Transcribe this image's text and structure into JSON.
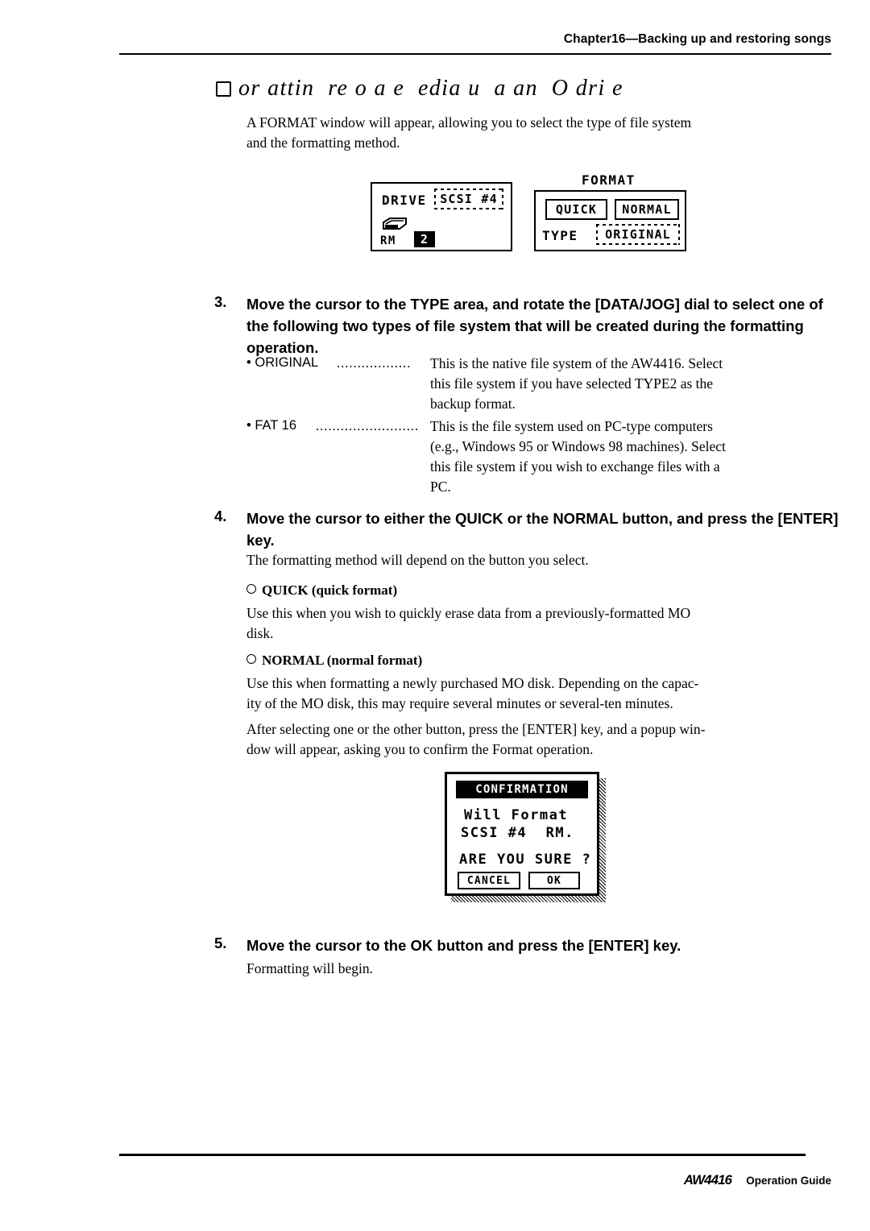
{
  "header": {
    "chapter": "Chapter16—Backing up and restoring songs"
  },
  "title": {
    "text": "or attin  re o a e  edia u  a an  O dri e"
  },
  "intro": {
    "line1": "A FORMAT window will appear, allowing you to select the type of file system",
    "line2": "and the formatting method."
  },
  "figure1": {
    "drive_label": "DRIVE",
    "drive_value": "SCSI #4",
    "rm_label": "RM",
    "rm_value": "2",
    "format_label": "FORMAT",
    "quick_button": "QUICK",
    "normal_button": "NORMAL",
    "type_label": "TYPE",
    "type_value": "ORIGINAL"
  },
  "step3": {
    "number": "3.",
    "line1": "Move the cursor to the TYPE area, and rotate the [DATA/JOG] dial to",
    "line2": "select one of the following two types of file system that will be created",
    "line3": "during the formatting operation."
  },
  "bullets": [
    {
      "name": "• ORIGINAL",
      "dots": "..................",
      "lines": [
        "This is the native file system of the AW4416. Select",
        "this file system if you have selected TYPE2 as the",
        "backup format."
      ]
    },
    {
      "name": "• FAT 16",
      "dots": ".........................",
      "lines": [
        "This is the file system used on PC-type computers",
        "(e.g., Windows 95 or Windows 98 machines). Select",
        "this file system if you wish to exchange files with a",
        "PC."
      ]
    }
  ],
  "step4": {
    "number": "4.",
    "line1": "Move the cursor to either the QUICK or the NORMAL button, and press",
    "line2": "the [ENTER] key.",
    "body": "The formatting method will depend on the button you select.",
    "quick_head": "QUICK (quick format)",
    "quick_body_l1": "Use this when you wish to quickly erase data from a previously-formatted MO",
    "quick_body_l2": "disk.",
    "normal_head": "NORMAL (normal format)",
    "normal_body_l1": "Use this when formatting a newly purchased MO disk. Depending on the capac-",
    "normal_body_l2": "ity of the MO disk, this may require several minutes or several-ten minutes.",
    "after_l1": "After selecting one or the other button, press the [ENTER] key, and a popup win-",
    "after_l2": "dow will appear, asking you to confirm the Format operation."
  },
  "figure2": {
    "title": "CONFIRMATION",
    "line1": "Will Format",
    "line2": "SCSI #4  RM.",
    "line3": "ARE YOU SURE ?",
    "cancel_button": "CANCEL",
    "ok_button": "OK"
  },
  "step5": {
    "number": "5.",
    "line1": "Move the cursor to the OK button and press the [ENTER] key.",
    "body": "Formatting will begin."
  },
  "footer": {
    "logo": "AW4416",
    "text": "Operation Guide"
  }
}
